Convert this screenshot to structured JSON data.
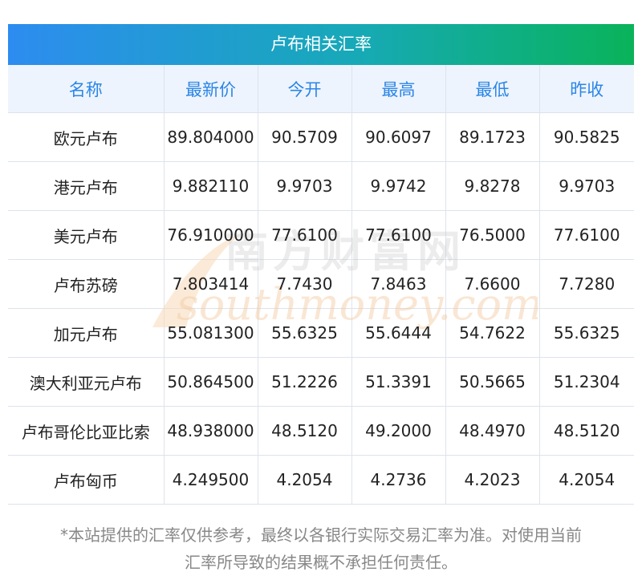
{
  "title": "卢布相关汇率",
  "columns": [
    "名称",
    "最新价",
    "今开",
    "最高",
    "最低",
    "昨收"
  ],
  "rows": [
    [
      "欧元卢布",
      "89.804000",
      "90.5709",
      "90.6097",
      "89.1723",
      "90.5825"
    ],
    [
      "港元卢布",
      "9.882110",
      "9.9703",
      "9.9742",
      "9.8278",
      "9.9703"
    ],
    [
      "美元卢布",
      "76.910000",
      "77.6100",
      "77.6100",
      "76.5000",
      "77.6100"
    ],
    [
      "卢布苏磅",
      "7.803414",
      "7.7430",
      "7.8463",
      "7.6600",
      "7.7280"
    ],
    [
      "加元卢布",
      "55.081300",
      "55.6325",
      "55.6444",
      "54.7622",
      "55.6325"
    ],
    [
      "澳大利亚元卢布",
      "50.864500",
      "51.2226",
      "51.3391",
      "50.5665",
      "51.2304"
    ],
    [
      "卢布哥伦比亚比索",
      "48.938000",
      "48.5120",
      "49.2000",
      "48.4970",
      "48.5120"
    ],
    [
      "卢布匈币",
      "4.249500",
      "4.2054",
      "4.2736",
      "4.2023",
      "4.2054"
    ]
  ],
  "watermark": {
    "cn": "南方财富网",
    "en": "southmoney.com"
  },
  "footnote": {
    "line1": "*本站提供的汇率仅供参考，最终以各银行实际交易汇率为准。对使用当前",
    "line2": "汇率所导致的结果概不承担任何责任。"
  },
  "colors": {
    "header_text": "#2a86e6",
    "header_bg": "#eef4fd",
    "title_gradient_start": "#2d8cf0",
    "title_gradient_end": "#09b35a"
  }
}
